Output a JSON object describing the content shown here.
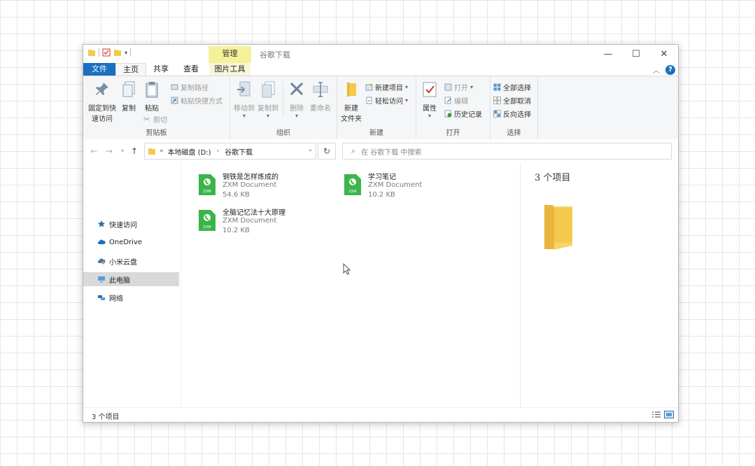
{
  "window": {
    "title": "谷歌下载",
    "context_tab": "管理",
    "controls": {
      "minimize": "—",
      "maximize": "☐",
      "close": "✕"
    }
  },
  "tabs": {
    "file": "文件",
    "home": "主页",
    "share": "共享",
    "view": "查看",
    "picture_tools": "图片工具"
  },
  "ribbon": {
    "clipboard": {
      "label": "剪贴板",
      "pin": "固定到快\n速访问",
      "pin_line1": "固定到快",
      "pin_line2": "速访问",
      "copy": "复制",
      "paste": "粘贴",
      "copy_path": "复制路径",
      "paste_shortcut": "粘贴快捷方式",
      "cut": "剪切"
    },
    "organize": {
      "label": "组织",
      "move_to": "移动到",
      "copy_to": "复制到",
      "delete": "删除",
      "rename": "重命名"
    },
    "new": {
      "label": "新建",
      "new_folder_line1": "新建",
      "new_folder_line2": "文件夹",
      "new_item": "新建项目",
      "easy_access": "轻松访问"
    },
    "open": {
      "label": "打开",
      "properties": "属性",
      "open": "打开",
      "edit": "编辑",
      "history": "历史记录"
    },
    "select": {
      "label": "选择",
      "select_all": "全部选择",
      "select_none": "全部取消",
      "invert": "反向选择"
    }
  },
  "address": {
    "root_chevron": "«",
    "drive": "本地磁盘 (D:)",
    "sep": "›",
    "folder": "谷歌下载",
    "search_placeholder": "在 谷歌下载 中搜索"
  },
  "nav": [
    {
      "label": "快速访问",
      "icon": "star-icon"
    },
    {
      "label": "OneDrive",
      "icon": "cloud-icon"
    },
    {
      "label": "小米云盘",
      "icon": "cloud-drive-icon"
    },
    {
      "label": "此电脑",
      "icon": "computer-icon",
      "selected": true
    },
    {
      "label": "网络",
      "icon": "network-icon"
    }
  ],
  "files": [
    {
      "name": "钢铁是怎样炼成的",
      "type": "ZXM Document",
      "size": "54.6 KB"
    },
    {
      "name": "学习笔记",
      "type": "ZXM Document",
      "size": "10.2 KB"
    },
    {
      "name": "全脑记忆法十大原理",
      "type": "ZXM Document",
      "size": "10.2 KB"
    }
  ],
  "file_icon_label": "ZXM",
  "preview": {
    "count": "3 个项目"
  },
  "status": {
    "count": "3 个项目"
  },
  "colors": {
    "accent": "#1a6fc0",
    "file_green": "#3bb54a",
    "folder_yellow": "#f5c94c",
    "manage_tab": "#f4f19a"
  }
}
